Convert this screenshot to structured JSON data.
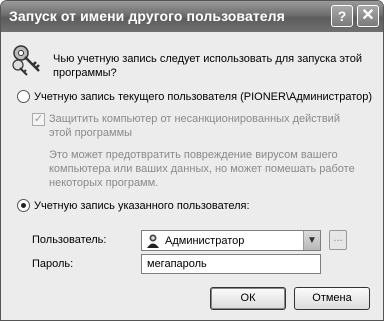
{
  "window": {
    "title": "Запуск от имени другого пользователя",
    "help_label": "?",
    "close_label": "✕"
  },
  "dialog": {
    "question": "Чью учетную запись следует использовать для запуска этой программы?",
    "option_current": {
      "label": "Учетную запись текущего пользователя (PIONER\\Администратор)",
      "checked": false
    },
    "protect_checkbox": {
      "label": "Защитить компьютер от несанкционированных действий этой программы",
      "checked": true,
      "enabled": false
    },
    "warning": "Это может предотвратить повреждение вирусом вашего компьютера или ваших данных, но может помешать работе некоторых программ.",
    "option_specified": {
      "label": "Учетную запись указанного пользователя:",
      "checked": true
    },
    "user": {
      "label": "Пользователь:",
      "value": "Администратор",
      "browse_label": "..."
    },
    "password": {
      "label": "Пароль:",
      "value": "мегапароль"
    },
    "ok_label": "ОК",
    "cancel_label": "Отмена"
  },
  "icons": {
    "keys": "keys-icon",
    "user_avatar": "user-avatar-icon",
    "dropdown": "chevron-down-icon"
  }
}
